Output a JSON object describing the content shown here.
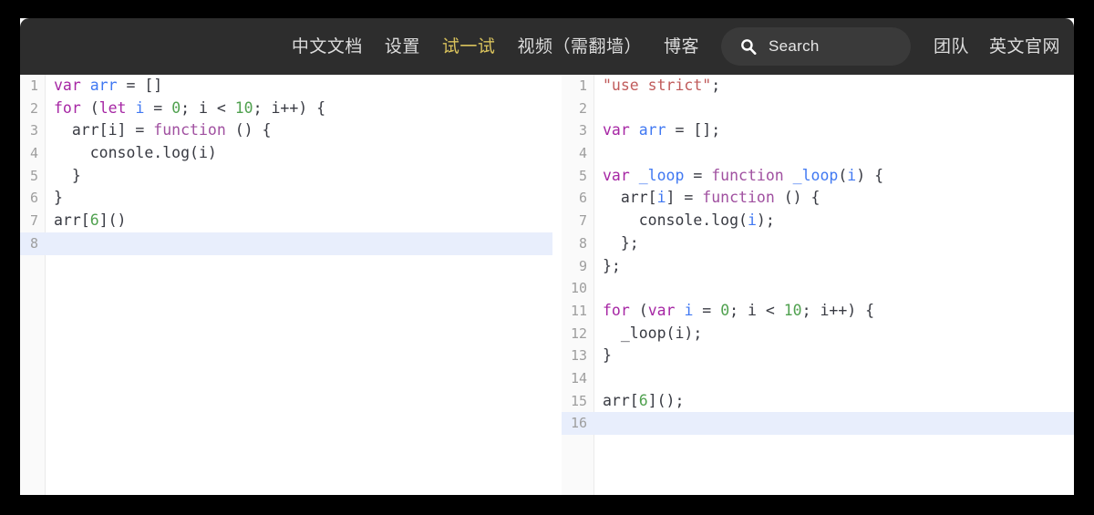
{
  "navbar": {
    "items": [
      {
        "label": "中文文档",
        "active": false,
        "name": "nav-item-chinese-docs"
      },
      {
        "label": "设置",
        "active": false,
        "name": "nav-item-settings"
      },
      {
        "label": "试一试",
        "active": true,
        "name": "nav-item-try-it-out"
      },
      {
        "label": "视频（需翻墙）",
        "active": false,
        "name": "nav-item-videos"
      },
      {
        "label": "博客",
        "active": false,
        "name": "nav-item-blog"
      }
    ],
    "right_items": [
      {
        "label": "团队",
        "name": "nav-item-team"
      },
      {
        "label": "英文官网",
        "name": "nav-item-english-site"
      }
    ],
    "search": {
      "placeholder": "Search",
      "icon": "search-icon",
      "value": ""
    },
    "colors": {
      "background": "#2d2d2d",
      "text": "#dcdcdc",
      "active_text": "#d9c25c",
      "search_background": "#3a3a3a"
    }
  },
  "editor_left": {
    "name": "source-editor",
    "highlighted_line": 8,
    "lines": [
      {
        "n": "1",
        "tokens": [
          {
            "t": "var",
            "c": "kw"
          },
          {
            "t": " ",
            "c": "pl"
          },
          {
            "t": "arr",
            "c": "var"
          },
          {
            "t": " = []",
            "c": "pl"
          }
        ]
      },
      {
        "n": "2",
        "tokens": [
          {
            "t": "for",
            "c": "kw"
          },
          {
            "t": " (",
            "c": "pl"
          },
          {
            "t": "let",
            "c": "kw"
          },
          {
            "t": " ",
            "c": "pl"
          },
          {
            "t": "i",
            "c": "var"
          },
          {
            "t": " = ",
            "c": "pl"
          },
          {
            "t": "0",
            "c": "num"
          },
          {
            "t": "; i < ",
            "c": "pl"
          },
          {
            "t": "10",
            "c": "num"
          },
          {
            "t": "; i++) {",
            "c": "pl"
          }
        ]
      },
      {
        "n": "3",
        "tokens": [
          {
            "t": "  arr[i] = ",
            "c": "pl"
          },
          {
            "t": "function",
            "c": "fn"
          },
          {
            "t": " () {",
            "c": "pl"
          }
        ]
      },
      {
        "n": "4",
        "tokens": [
          {
            "t": "    console.log(i)",
            "c": "pl"
          }
        ]
      },
      {
        "n": "5",
        "tokens": [
          {
            "t": "  }",
            "c": "pl"
          }
        ]
      },
      {
        "n": "6",
        "tokens": [
          {
            "t": "}",
            "c": "pl"
          }
        ]
      },
      {
        "n": "7",
        "tokens": [
          {
            "t": "arr[",
            "c": "pl"
          },
          {
            "t": "6",
            "c": "num"
          },
          {
            "t": "]()",
            "c": "pl"
          }
        ]
      },
      {
        "n": "8",
        "tokens": []
      }
    ]
  },
  "editor_right": {
    "name": "output-editor",
    "highlighted_line": 16,
    "lines": [
      {
        "n": "1",
        "tokens": [
          {
            "t": "\"use strict\"",
            "c": "str"
          },
          {
            "t": ";",
            "c": "pl"
          }
        ]
      },
      {
        "n": "2",
        "tokens": []
      },
      {
        "n": "3",
        "tokens": [
          {
            "t": "var",
            "c": "kw"
          },
          {
            "t": " ",
            "c": "pl"
          },
          {
            "t": "arr",
            "c": "var"
          },
          {
            "t": " = [];",
            "c": "pl"
          }
        ]
      },
      {
        "n": "4",
        "tokens": []
      },
      {
        "n": "5",
        "tokens": [
          {
            "t": "var",
            "c": "kw"
          },
          {
            "t": " ",
            "c": "pl"
          },
          {
            "t": "_loop",
            "c": "var"
          },
          {
            "t": " = ",
            "c": "pl"
          },
          {
            "t": "function",
            "c": "fn"
          },
          {
            "t": " ",
            "c": "pl"
          },
          {
            "t": "_loop",
            "c": "var"
          },
          {
            "t": "(",
            "c": "pl"
          },
          {
            "t": "i",
            "c": "var"
          },
          {
            "t": ") {",
            "c": "pl"
          }
        ]
      },
      {
        "n": "6",
        "tokens": [
          {
            "t": "  arr[",
            "c": "pl"
          },
          {
            "t": "i",
            "c": "var"
          },
          {
            "t": "] = ",
            "c": "pl"
          },
          {
            "t": "function",
            "c": "fn"
          },
          {
            "t": " () {",
            "c": "pl"
          }
        ]
      },
      {
        "n": "7",
        "tokens": [
          {
            "t": "    console.log(",
            "c": "pl"
          },
          {
            "t": "i",
            "c": "var"
          },
          {
            "t": ");",
            "c": "pl"
          }
        ]
      },
      {
        "n": "8",
        "tokens": [
          {
            "t": "  };",
            "c": "pl"
          }
        ]
      },
      {
        "n": "9",
        "tokens": [
          {
            "t": "};",
            "c": "pl"
          }
        ]
      },
      {
        "n": "10",
        "tokens": []
      },
      {
        "n": "11",
        "tokens": [
          {
            "t": "for",
            "c": "kw"
          },
          {
            "t": " (",
            "c": "pl"
          },
          {
            "t": "var",
            "c": "kw"
          },
          {
            "t": " ",
            "c": "pl"
          },
          {
            "t": "i",
            "c": "var"
          },
          {
            "t": " = ",
            "c": "pl"
          },
          {
            "t": "0",
            "c": "num"
          },
          {
            "t": "; i < ",
            "c": "pl"
          },
          {
            "t": "10",
            "c": "num"
          },
          {
            "t": "; i++) {",
            "c": "pl"
          }
        ]
      },
      {
        "n": "12",
        "tokens": [
          {
            "t": "  _loop(i);",
            "c": "pl"
          }
        ]
      },
      {
        "n": "13",
        "tokens": [
          {
            "t": "}",
            "c": "pl"
          }
        ]
      },
      {
        "n": "14",
        "tokens": []
      },
      {
        "n": "15",
        "tokens": [
          {
            "t": "arr[",
            "c": "pl"
          },
          {
            "t": "6",
            "c": "num"
          },
          {
            "t": "]();",
            "c": "pl"
          }
        ]
      },
      {
        "n": "16",
        "tokens": []
      }
    ]
  },
  "theme": {
    "keyword": "#a626a4",
    "variable": "#4078f2",
    "number": "#50a14f",
    "string": "#c05b5b",
    "function": "#a050a0",
    "plain": "#383a42",
    "line_number": "#9e9e9e",
    "highlight_line": "#e8eefc",
    "gutter_background": "#fafafa",
    "editor_background": "#ffffff",
    "frame": "#000000"
  }
}
